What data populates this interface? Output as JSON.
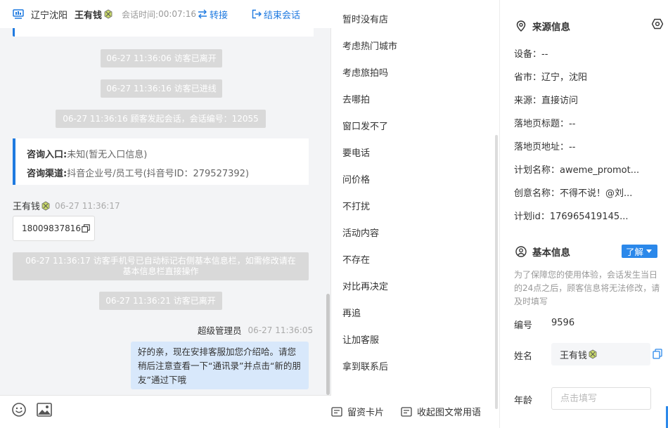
{
  "header": {
    "location": "辽宁沈阳",
    "visitor_name": "王有钱",
    "timer_label": "会话时间:",
    "timer": "00:07:16",
    "transfer": "转接",
    "end_chat": "结束会话"
  },
  "chat": {
    "system_messages": [
      "06-27 11:36:06 访客已离开",
      "06-27 11:36:16 访客已进线",
      "06-27 11:36:16 顾客发起会话，会话编号：12055",
      "06-27 11:36:17 访客手机号已自动标记右侧基本信息栏，如需修改请在基本信息栏直接操作",
      "06-27 11:36:21 访客已离开"
    ],
    "info_card": {
      "entry_label": "咨询入口:",
      "entry_value": "未知(暂无入口信息)",
      "channel_label": "咨询渠道:",
      "channel_value": "抖音企业号/员工号(抖音号ID：279527392)"
    },
    "visitor_msg": {
      "sender": "王有钱",
      "time": "06-27 11:36:17",
      "text": "18009837816"
    },
    "agent_msg": {
      "sender": "超级管理员",
      "time": "06-27 11:36:05",
      "text": "好的亲，现在安排客服加您介绍哈。请您稍后注意查看一下“通讯录”并点击“新的朋友”通过下哦"
    }
  },
  "quick_replies": {
    "items": [
      "暂时没有店",
      "考虑热门城市",
      "考虑旅拍吗",
      "去哪拍",
      "窗口发不了",
      "要电话",
      "问价格",
      "不打扰",
      "活动内容",
      "不存在",
      "对比再决定",
      "再追",
      "让加客服",
      "拿到联系后"
    ],
    "footer": {
      "card_button": "留资卡片",
      "collapse_button": "收起图文常用语"
    }
  },
  "source_info": {
    "title": "来源信息",
    "rows": [
      "设备：--",
      "省市：辽宁，沈阳",
      "来源：直接访问",
      "落地页标题：--",
      "落地页地址：--",
      "计划名称：aweme_promot...",
      "创意名称：不得不说！@刘...",
      "计划id：176965419145..."
    ]
  },
  "basic_info": {
    "title": "基本信息",
    "learn_button": "了解",
    "notice": "为了保障您的使用体验，会话发生当日的24点之后，顾客信息将无法修改，请及时填写",
    "id_label": "编号",
    "id_value": "9596",
    "name_label": "姓名",
    "name_value": "王有钱",
    "age_label": "年龄",
    "age_placeholder": "点击填写"
  },
  "colors": {
    "accent": "#1f7ae0",
    "system_msg_bg": "#d9d9d9",
    "agent_bubble_bg": "#d8e8fb",
    "chat_bg": "#f3f4f6"
  }
}
